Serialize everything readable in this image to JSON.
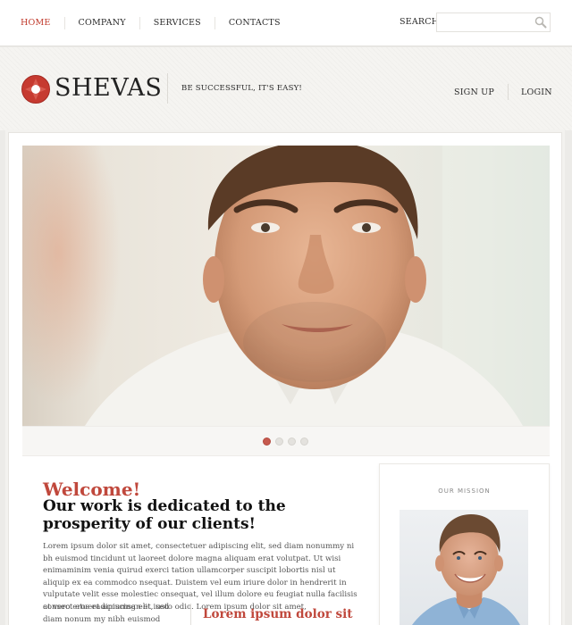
{
  "nav": {
    "items": [
      {
        "label": "HOME",
        "active": true
      },
      {
        "label": "COMPANY",
        "active": false
      },
      {
        "label": "SERVICES",
        "active": false
      },
      {
        "label": "CONTACTS",
        "active": false
      }
    ],
    "search_label": "SEARCH",
    "search_placeholder": ""
  },
  "header": {
    "brand": "SHEVAS",
    "tagline": "BE SUCCESSFUL, IT'S EASY!",
    "signup_label": "SIGN UP",
    "login_label": "LOGIN"
  },
  "slider": {
    "dot_count": 4,
    "active_dot": 0
  },
  "intro": {
    "welcome": "Welcome!",
    "lead": "Our work is dedicated to the prosperity of our clients!",
    "paragraph": "Lorem ipsum dolor sit amet, consectetuer adipiscing elit, sed diam nonummy ni bh euismod tincidunt ut laoreet dolore magna aliquam erat volutpat. Ut wisi enimaminim venia quirud exerci tation ullamcorper suscipit lobortis nisl ut aliquip ex ea commodco nsequat. Duistem vel eum iriure dolor in hendrerit in vulputate velit esse molestiec onsequat, vel illum dolore eu feugiat nulla facilisis at vero eros et accumsan et iusto odio. Lorem ipsum dolor sit amet,",
    "paragraph2": "consect etueradipiscing elit, sed diam nonum my nibh euismod tincidunt ut",
    "subheading": "Lorem ipsum dolor sit"
  },
  "mission": {
    "title": "OUR MISSION"
  },
  "colors": {
    "accent": "#c0483c",
    "panel": "#ffffff",
    "background": "#ecebe8"
  }
}
